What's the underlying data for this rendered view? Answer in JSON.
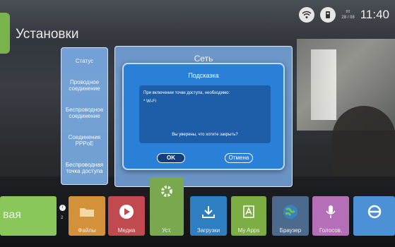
{
  "status_bar": {
    "date_top": "пт",
    "date_bottom": "28 / 08",
    "time": "11:40",
    "icons": [
      "wifi-icon",
      "usb-icon"
    ]
  },
  "page": {
    "title": "Установки"
  },
  "side_menu": {
    "items": [
      {
        "label": "Статус"
      },
      {
        "label": "Проводное соединение"
      },
      {
        "label": "Беспроводное соединение"
      },
      {
        "label": "Соединение PPPoE"
      },
      {
        "label": "Беспроводная точка доступа"
      }
    ]
  },
  "network_panel": {
    "title": "Сеть"
  },
  "dialog": {
    "title": "Подсказка",
    "line1": "При включении точки доступа, необходимо:",
    "line2": "* Wi-Fi",
    "question": "Вы уверены, что хотите закрыть?",
    "ok_label": "OK",
    "cancel_label": "Отмена"
  },
  "apps": {
    "left_big": "вая",
    "badge": "i",
    "badge_num": "2",
    "tiles": [
      {
        "label": "Файлы",
        "icon": "folder-icon"
      },
      {
        "label": "Медиа",
        "icon": "play-icon"
      },
      {
        "label": "Уст.",
        "icon": "gear-icon"
      },
      {
        "label": "Загрузки",
        "icon": "download-icon"
      },
      {
        "label": "My Apps",
        "icon": "apps-icon"
      },
      {
        "label": "Браузер",
        "icon": "globe-icon"
      },
      {
        "label": "Голосов.",
        "icon": "mic-icon"
      },
      {
        "label": "",
        "icon": "ie-icon"
      }
    ]
  },
  "colors": {
    "dialog_bg": "#2a7fd6",
    "dialog_body": "#1e5ea8",
    "side_menu_bg": "#7aaae2"
  }
}
